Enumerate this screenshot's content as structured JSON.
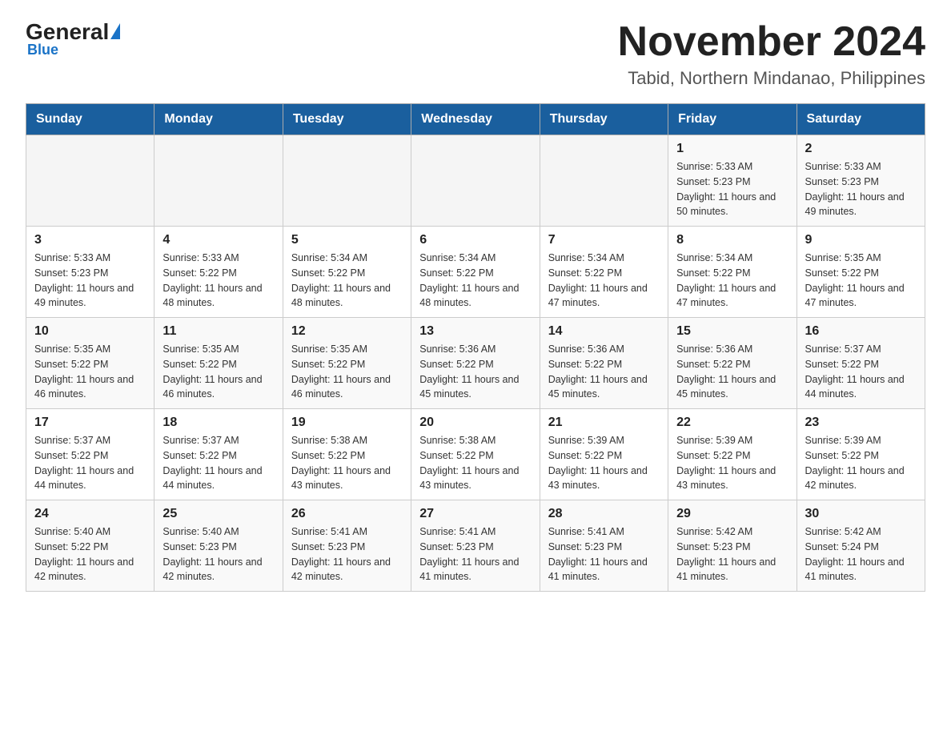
{
  "logo": {
    "general": "General",
    "blue": "Blue",
    "triangle": "▶"
  },
  "header": {
    "title": "November 2024",
    "subtitle": "Tabid, Northern Mindanao, Philippines"
  },
  "days_of_week": [
    "Sunday",
    "Monday",
    "Tuesday",
    "Wednesday",
    "Thursday",
    "Friday",
    "Saturday"
  ],
  "weeks": [
    [
      {
        "day": "",
        "info": ""
      },
      {
        "day": "",
        "info": ""
      },
      {
        "day": "",
        "info": ""
      },
      {
        "day": "",
        "info": ""
      },
      {
        "day": "",
        "info": ""
      },
      {
        "day": "1",
        "info": "Sunrise: 5:33 AM\nSunset: 5:23 PM\nDaylight: 11 hours and 50 minutes."
      },
      {
        "day": "2",
        "info": "Sunrise: 5:33 AM\nSunset: 5:23 PM\nDaylight: 11 hours and 49 minutes."
      }
    ],
    [
      {
        "day": "3",
        "info": "Sunrise: 5:33 AM\nSunset: 5:23 PM\nDaylight: 11 hours and 49 minutes."
      },
      {
        "day": "4",
        "info": "Sunrise: 5:33 AM\nSunset: 5:22 PM\nDaylight: 11 hours and 48 minutes."
      },
      {
        "day": "5",
        "info": "Sunrise: 5:34 AM\nSunset: 5:22 PM\nDaylight: 11 hours and 48 minutes."
      },
      {
        "day": "6",
        "info": "Sunrise: 5:34 AM\nSunset: 5:22 PM\nDaylight: 11 hours and 48 minutes."
      },
      {
        "day": "7",
        "info": "Sunrise: 5:34 AM\nSunset: 5:22 PM\nDaylight: 11 hours and 47 minutes."
      },
      {
        "day": "8",
        "info": "Sunrise: 5:34 AM\nSunset: 5:22 PM\nDaylight: 11 hours and 47 minutes."
      },
      {
        "day": "9",
        "info": "Sunrise: 5:35 AM\nSunset: 5:22 PM\nDaylight: 11 hours and 47 minutes."
      }
    ],
    [
      {
        "day": "10",
        "info": "Sunrise: 5:35 AM\nSunset: 5:22 PM\nDaylight: 11 hours and 46 minutes."
      },
      {
        "day": "11",
        "info": "Sunrise: 5:35 AM\nSunset: 5:22 PM\nDaylight: 11 hours and 46 minutes."
      },
      {
        "day": "12",
        "info": "Sunrise: 5:35 AM\nSunset: 5:22 PM\nDaylight: 11 hours and 46 minutes."
      },
      {
        "day": "13",
        "info": "Sunrise: 5:36 AM\nSunset: 5:22 PM\nDaylight: 11 hours and 45 minutes."
      },
      {
        "day": "14",
        "info": "Sunrise: 5:36 AM\nSunset: 5:22 PM\nDaylight: 11 hours and 45 minutes."
      },
      {
        "day": "15",
        "info": "Sunrise: 5:36 AM\nSunset: 5:22 PM\nDaylight: 11 hours and 45 minutes."
      },
      {
        "day": "16",
        "info": "Sunrise: 5:37 AM\nSunset: 5:22 PM\nDaylight: 11 hours and 44 minutes."
      }
    ],
    [
      {
        "day": "17",
        "info": "Sunrise: 5:37 AM\nSunset: 5:22 PM\nDaylight: 11 hours and 44 minutes."
      },
      {
        "day": "18",
        "info": "Sunrise: 5:37 AM\nSunset: 5:22 PM\nDaylight: 11 hours and 44 minutes."
      },
      {
        "day": "19",
        "info": "Sunrise: 5:38 AM\nSunset: 5:22 PM\nDaylight: 11 hours and 43 minutes."
      },
      {
        "day": "20",
        "info": "Sunrise: 5:38 AM\nSunset: 5:22 PM\nDaylight: 11 hours and 43 minutes."
      },
      {
        "day": "21",
        "info": "Sunrise: 5:39 AM\nSunset: 5:22 PM\nDaylight: 11 hours and 43 minutes."
      },
      {
        "day": "22",
        "info": "Sunrise: 5:39 AM\nSunset: 5:22 PM\nDaylight: 11 hours and 43 minutes."
      },
      {
        "day": "23",
        "info": "Sunrise: 5:39 AM\nSunset: 5:22 PM\nDaylight: 11 hours and 42 minutes."
      }
    ],
    [
      {
        "day": "24",
        "info": "Sunrise: 5:40 AM\nSunset: 5:22 PM\nDaylight: 11 hours and 42 minutes."
      },
      {
        "day": "25",
        "info": "Sunrise: 5:40 AM\nSunset: 5:23 PM\nDaylight: 11 hours and 42 minutes."
      },
      {
        "day": "26",
        "info": "Sunrise: 5:41 AM\nSunset: 5:23 PM\nDaylight: 11 hours and 42 minutes."
      },
      {
        "day": "27",
        "info": "Sunrise: 5:41 AM\nSunset: 5:23 PM\nDaylight: 11 hours and 41 minutes."
      },
      {
        "day": "28",
        "info": "Sunrise: 5:41 AM\nSunset: 5:23 PM\nDaylight: 11 hours and 41 minutes."
      },
      {
        "day": "29",
        "info": "Sunrise: 5:42 AM\nSunset: 5:23 PM\nDaylight: 11 hours and 41 minutes."
      },
      {
        "day": "30",
        "info": "Sunrise: 5:42 AM\nSunset: 5:24 PM\nDaylight: 11 hours and 41 minutes."
      }
    ]
  ]
}
